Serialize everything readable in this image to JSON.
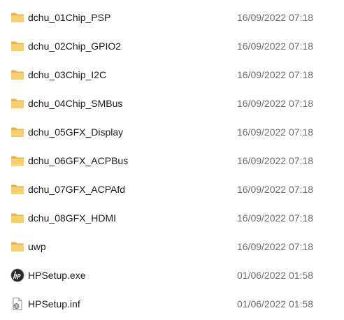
{
  "files": [
    {
      "name": "dchu_01Chip_PSP",
      "modified": "16/09/2022 07:18",
      "icon": "folder-icon"
    },
    {
      "name": "dchu_02Chip_GPIO2",
      "modified": "16/09/2022 07:18",
      "icon": "folder-icon"
    },
    {
      "name": "dchu_03Chip_I2C",
      "modified": "16/09/2022 07:18",
      "icon": "folder-icon"
    },
    {
      "name": "dchu_04Chip_SMBus",
      "modified": "16/09/2022 07:18",
      "icon": "folder-icon"
    },
    {
      "name": "dchu_05GFX_Display",
      "modified": "16/09/2022 07:18",
      "icon": "folder-icon"
    },
    {
      "name": "dchu_06GFX_ACPBus",
      "modified": "16/09/2022 07:18",
      "icon": "folder-icon"
    },
    {
      "name": "dchu_07GFX_ACPAfd",
      "modified": "16/09/2022 07:18",
      "icon": "folder-icon"
    },
    {
      "name": "dchu_08GFX_HDMI",
      "modified": "16/09/2022 07:18",
      "icon": "folder-icon"
    },
    {
      "name": "uwp",
      "modified": "16/09/2022 07:18",
      "icon": "folder-icon"
    },
    {
      "name": "HPSetup.exe",
      "modified": "01/06/2022 01:58",
      "icon": "hp-app-icon"
    },
    {
      "name": "HPSetup.inf",
      "modified": "01/06/2022 01:58",
      "icon": "setup-info-file-icon"
    }
  ],
  "colors": {
    "folder_body": "#f8d06b",
    "folder_tab": "#e8b546",
    "date_text": "#6d6d6d",
    "name_text": "#1a1a1a"
  }
}
